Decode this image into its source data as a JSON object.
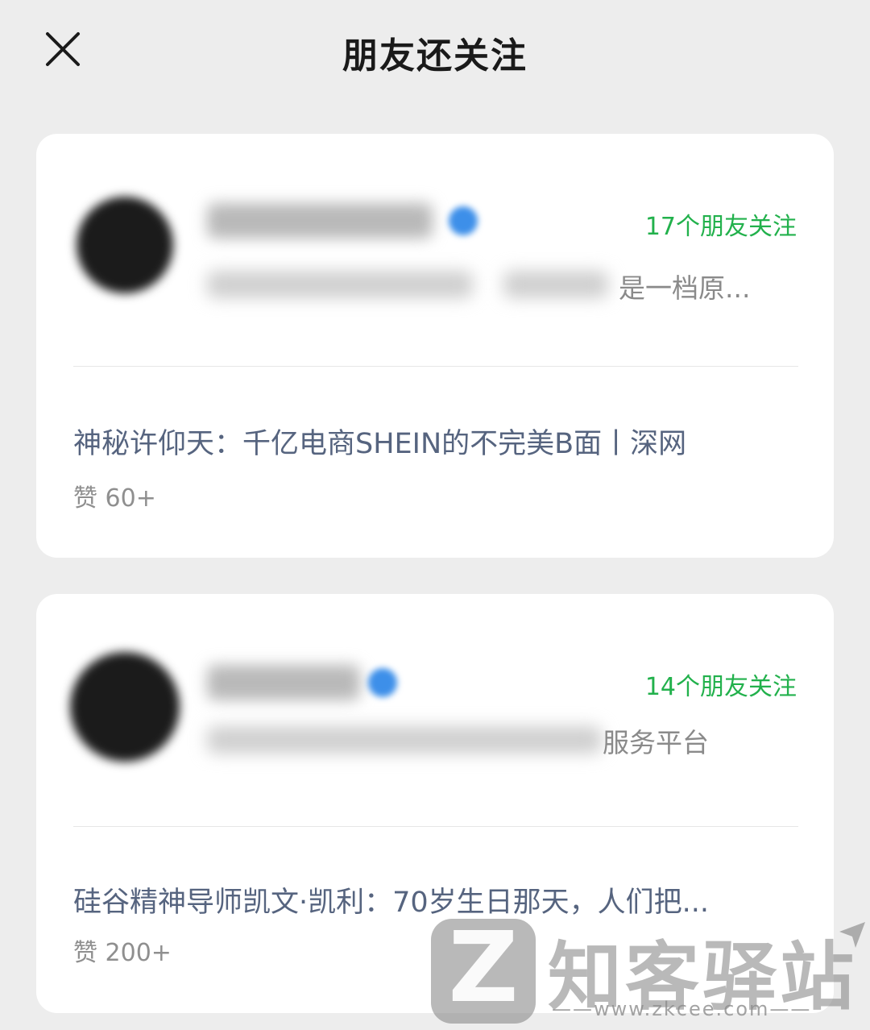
{
  "header": {
    "title": "朋友还关注",
    "close_icon": "close-icon"
  },
  "accounts": [
    {
      "friends_following": "17个朋友关注",
      "description_visible": "是一档原...",
      "article_title": "神秘许仰天：千亿电商SHEIN的不完美B面丨深网",
      "likes": "赞 60+"
    },
    {
      "friends_following": "14个朋友关注",
      "description_visible": "服务平台",
      "article_title": "硅谷精神导师凯文·凯利：70岁生日那天，人们把...",
      "likes": "赞 200+"
    }
  ],
  "colors": {
    "friends_text": "#22b14c",
    "article_link": "#56647f",
    "verified_badge": "#3d8fe9",
    "page_background": "#ededed"
  },
  "watermark": {
    "logo_letter": "Z",
    "name": "知客驿站",
    "url": "——www.zkcee.com——"
  }
}
